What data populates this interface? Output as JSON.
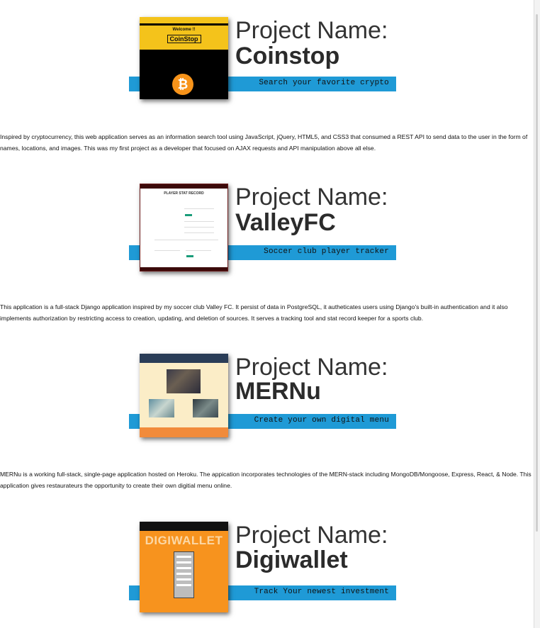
{
  "projects": [
    {
      "label": "Project Name:",
      "name": "Coinstop",
      "tagline": "Search your favorite crypto",
      "description": "Inspired by cryptocurrency, this web application serves as an information search tool using JavaScript, jQuery, HTML5, and CSS3 that consumed a REST API to send data to the user in the form of names, locations, and images. This was my first project as a developer that focused on AJAX requests and API manipulation above all else."
    },
    {
      "label": "Project Name:",
      "name": "ValleyFC",
      "tagline": "Soccer club player tracker",
      "description": "This application is a full-stack Django application inspired by my soccer club Valley FC. It persist of data in PostgreSQL, it autheticates users using Django's built-in authentication and it also implements authorization by restricting access to creation, updating, and deletion of sources. It serves a tracking tool and stat record keeper for a sports club."
    },
    {
      "label": "Project Name:",
      "name": "MERNu",
      "tagline": "Create your own digital menu",
      "description": "MERNu is a working full-stack, single-page application hosted on Heroku. The appication incorporates technologies of the MERN-stack including MongoDB/Mongoose, Express, React, & Node. This application gives restaurateurs the opportunity to create their own digitial menu online."
    },
    {
      "label": "Project Name:",
      "name": "Digiwallet",
      "tagline": "Track Your newest investment",
      "description": ""
    }
  ],
  "thumbs": {
    "coinstop": {
      "welcome": "Welcome !!",
      "logo": "CoinStop"
    },
    "valleyfc": {
      "title": "PLAYER STAT RECORD"
    },
    "digiwallet": {
      "logo": "DIGIWALLET"
    }
  },
  "colors": {
    "accent_bar": "#1f9ad6",
    "coinstop_yellow": "#f4c31b",
    "digiwallet_orange": "#f7931e"
  }
}
